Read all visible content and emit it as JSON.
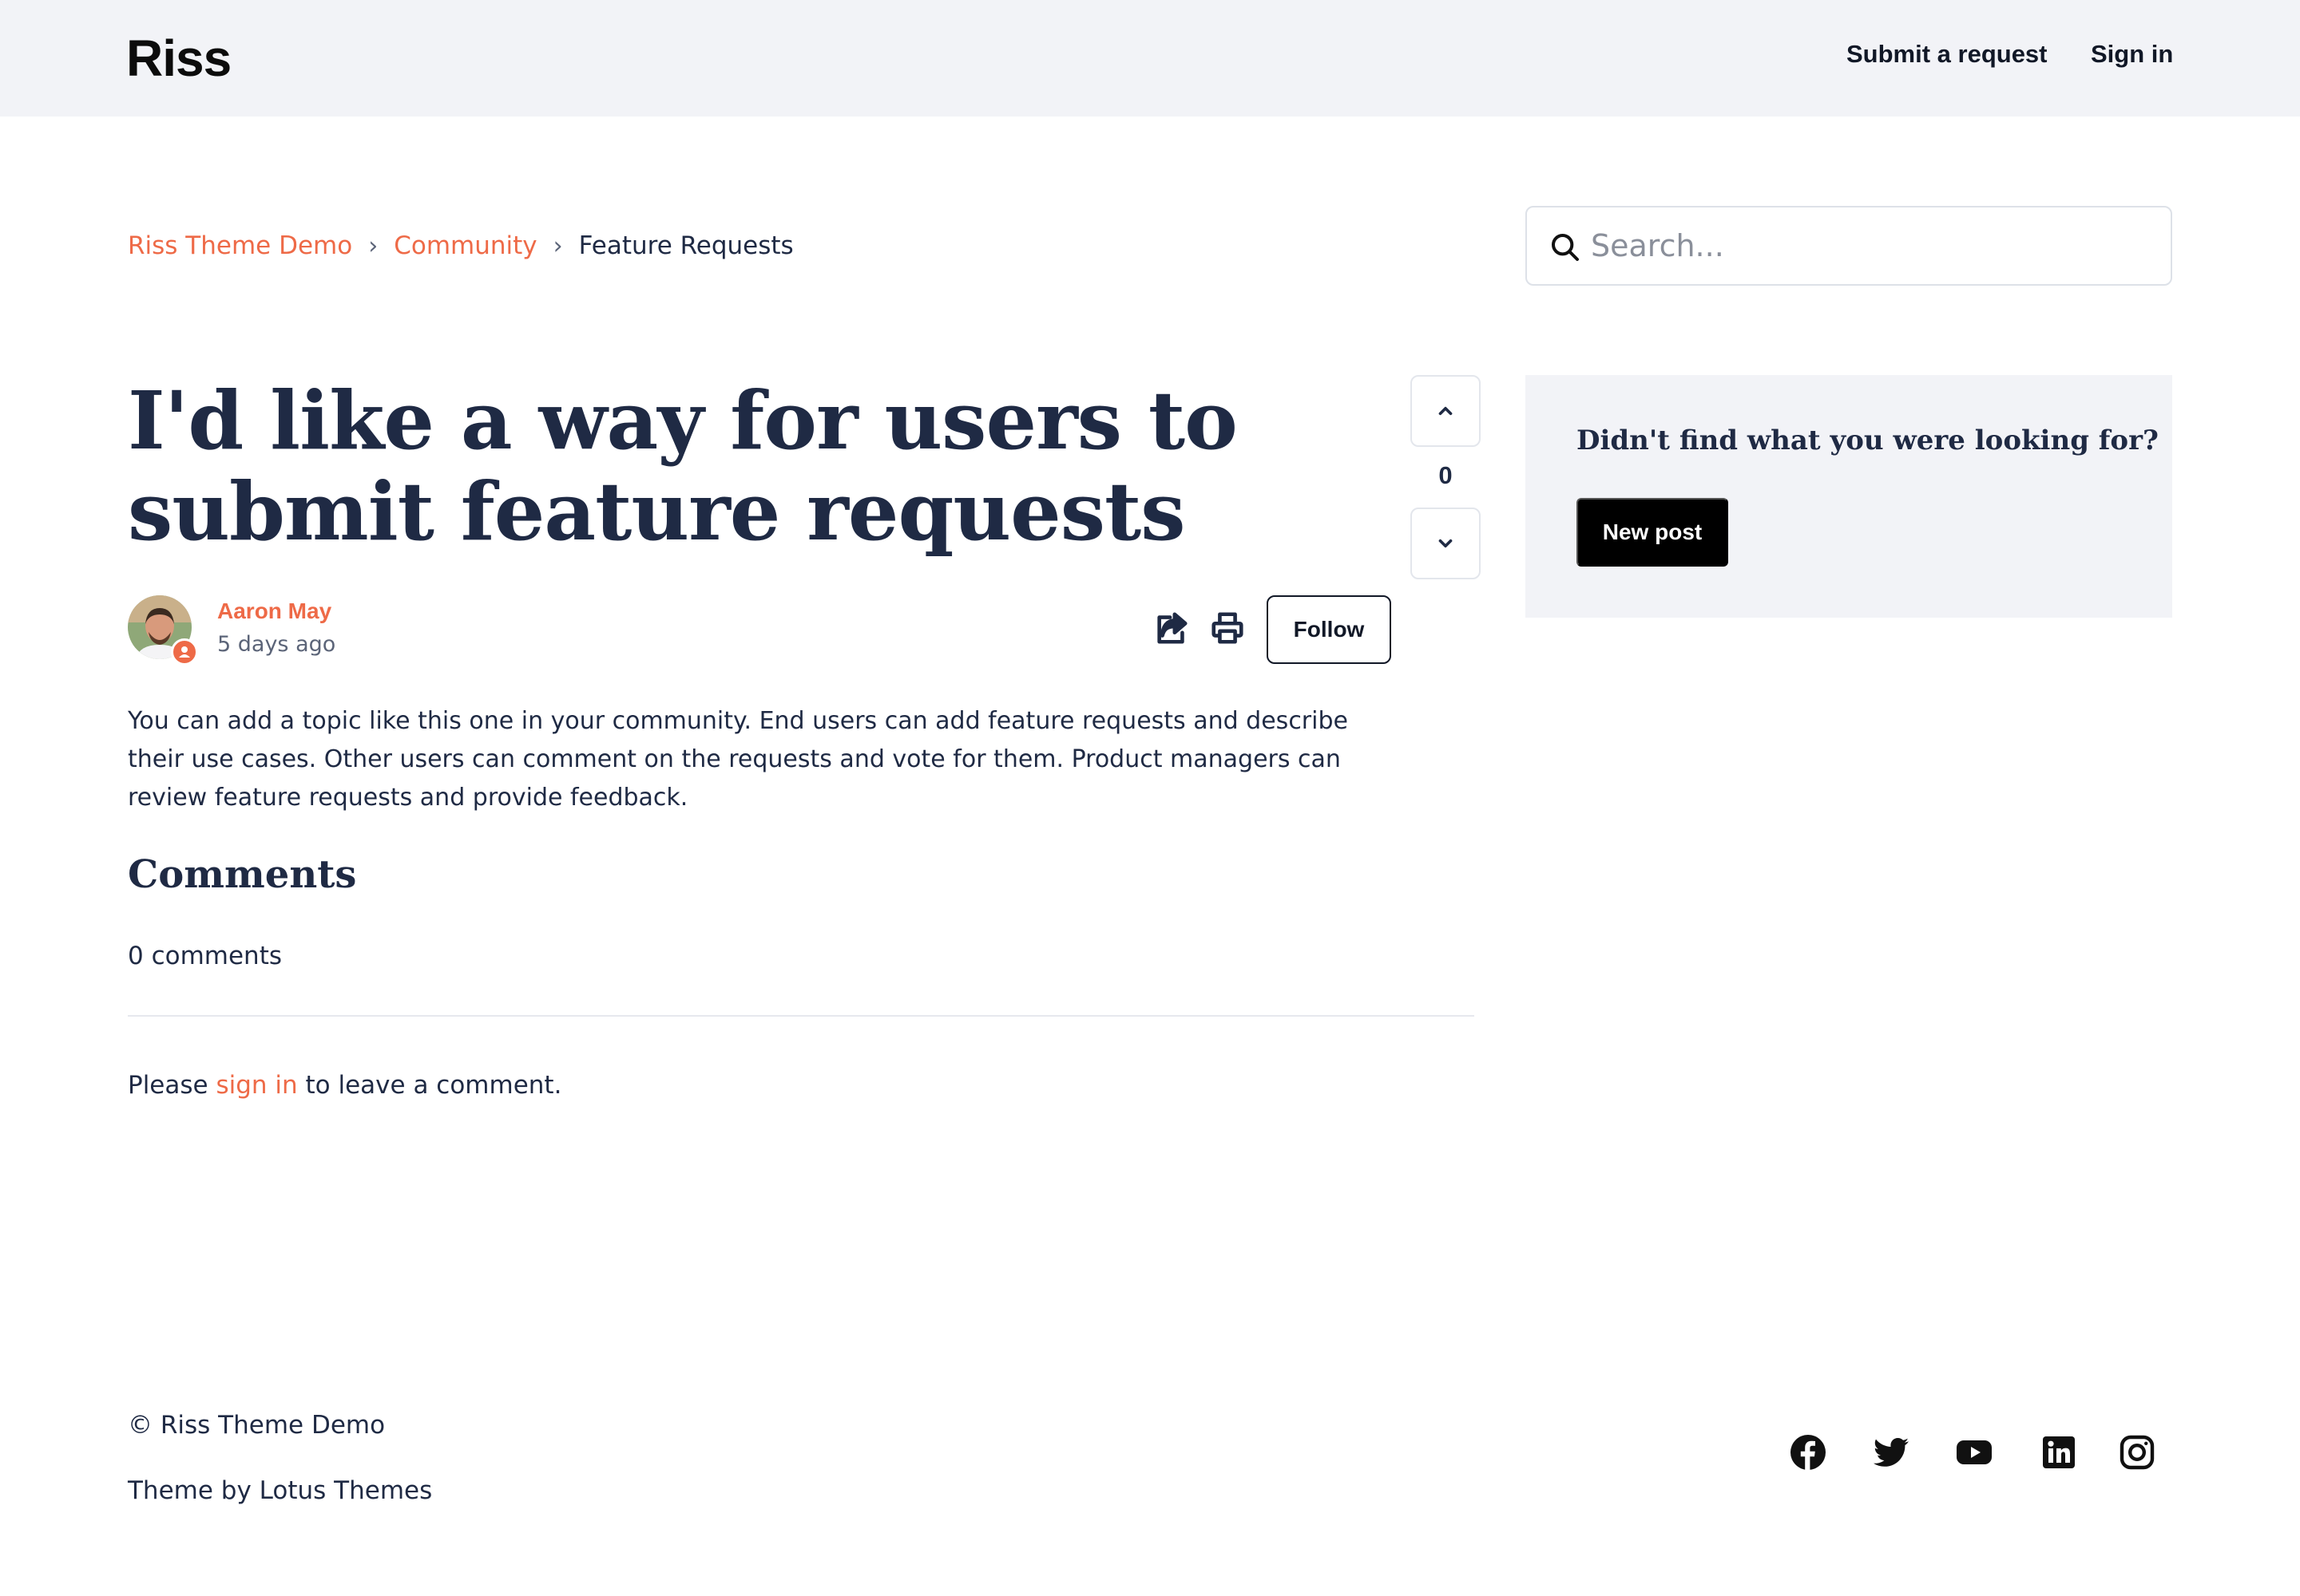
{
  "header": {
    "logo": "Riss",
    "nav": {
      "submit_request": "Submit a request",
      "sign_in": "Sign in"
    }
  },
  "breadcrumb": {
    "items": [
      "Riss Theme Demo",
      "Community",
      "Feature Requests"
    ],
    "separator": "›"
  },
  "search": {
    "placeholder": "Search..."
  },
  "post": {
    "title": "I'd like a way for users to submit feature requests",
    "author": "Aaron May",
    "time": "5 days ago",
    "vote_count": "0",
    "follow_label": "Follow",
    "body": "You can add a topic like this one in your community. End users can add feature requests and describe their use cases. Other users can comment on the requests and vote for them. Product managers can review feature requests and provide feedback."
  },
  "comments": {
    "heading": "Comments",
    "count_text": "0 comments",
    "signin_prefix": "Please ",
    "signin_link": "sign in",
    "signin_suffix": " to leave a comment."
  },
  "sidebar": {
    "card_title": "Didn't find what you were looking for?",
    "new_post_label": "New post"
  },
  "footer": {
    "copyright": "© Riss Theme Demo",
    "theme_credit": "Theme by Lotus Themes",
    "social": [
      "facebook-icon",
      "twitter-icon",
      "youtube-icon",
      "linkedin-icon",
      "instagram-icon"
    ]
  },
  "colors": {
    "accent": "#ee6a47",
    "text": "#1f2a44",
    "header_bg": "#f2f3f7",
    "button_dark": "#000000"
  }
}
